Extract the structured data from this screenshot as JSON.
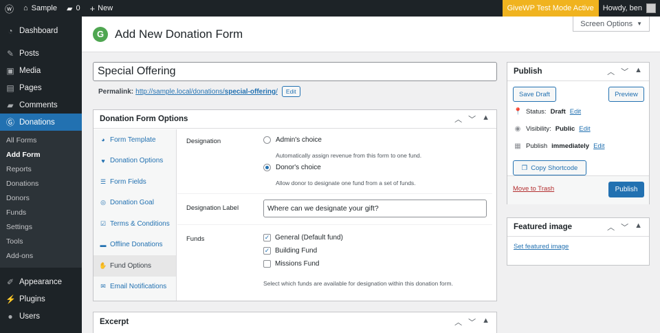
{
  "adminbar": {
    "site_name": "Sample",
    "comments_count": "0",
    "new_label": "New",
    "test_mode": "GiveWP Test Mode Active",
    "howdy": "Howdy, ben"
  },
  "sidebar": {
    "items": [
      {
        "label": "Dashboard",
        "icon": "dashboard-icon"
      },
      {
        "label": "Posts",
        "icon": "pin-icon"
      },
      {
        "label": "Media",
        "icon": "media-icon"
      },
      {
        "label": "Pages",
        "icon": "pages-icon"
      },
      {
        "label": "Comments",
        "icon": "comment-icon"
      },
      {
        "label": "Donations",
        "icon": "give-icon"
      }
    ],
    "submenu": [
      "All Forms",
      "Add Form",
      "Reports",
      "Donations",
      "Donors",
      "Funds",
      "Settings",
      "Tools",
      "Add-ons"
    ],
    "bottom": [
      {
        "label": "Appearance",
        "icon": "brush-icon"
      },
      {
        "label": "Plugins",
        "icon": "plugin-icon"
      },
      {
        "label": "Users",
        "icon": "user-icon"
      }
    ]
  },
  "header": {
    "title": "Add New Donation Form",
    "screen_options": "Screen Options"
  },
  "form": {
    "title_value": "Special Offering",
    "permalink_label": "Permalink:",
    "permalink_base": "http://sample.local/donations/",
    "permalink_slug": "special-offering",
    "permalink_end": "/",
    "edit_label": "Edit"
  },
  "options": {
    "title": "Donation Form Options",
    "tabs": [
      {
        "label": "Form Template",
        "icon": "palette-icon"
      },
      {
        "label": "Donation Options",
        "icon": "heart-icon"
      },
      {
        "label": "Form Fields",
        "icon": "list-icon"
      },
      {
        "label": "Donation Goal",
        "icon": "target-icon"
      },
      {
        "label": "Terms & Conditions",
        "icon": "checkbox-icon"
      },
      {
        "label": "Offline Donations",
        "icon": "card-icon"
      },
      {
        "label": "Fund Options",
        "icon": "hand-icon"
      },
      {
        "label": "Email Notifications",
        "icon": "mail-icon"
      }
    ],
    "designation": {
      "label": "Designation",
      "admin_choice": "Admin's choice",
      "admin_desc": "Automatically assign revenue from this form to one fund.",
      "donor_choice": "Donor's choice",
      "donor_desc": "Allow donor to designate one fund from a set of funds."
    },
    "designation_label": {
      "label": "Designation Label",
      "value": "Where can we designate your gift?"
    },
    "funds": {
      "label": "Funds",
      "items": [
        {
          "name": "General (Default fund)",
          "checked": true
        },
        {
          "name": "Building Fund",
          "checked": true
        },
        {
          "name": "Missions Fund",
          "checked": false
        }
      ],
      "desc": "Select which funds are available for designation within this donation form."
    }
  },
  "excerpt": {
    "title": "Excerpt"
  },
  "publish": {
    "title": "Publish",
    "save_draft": "Save Draft",
    "preview": "Preview",
    "status_label": "Status:",
    "status_value": "Draft",
    "visibility_label": "Visibility:",
    "visibility_value": "Public",
    "publish_label": "Publish",
    "publish_value": "immediately",
    "edit": "Edit",
    "copy_shortcode": "Copy Shortcode",
    "trash": "Move to Trash",
    "publish_button": "Publish"
  },
  "featured": {
    "title": "Featured image",
    "set_link": "Set featured image"
  },
  "colors": {
    "accent": "#2271b1",
    "test_mode": "#f0b31f",
    "give_green": "#4fa651"
  }
}
